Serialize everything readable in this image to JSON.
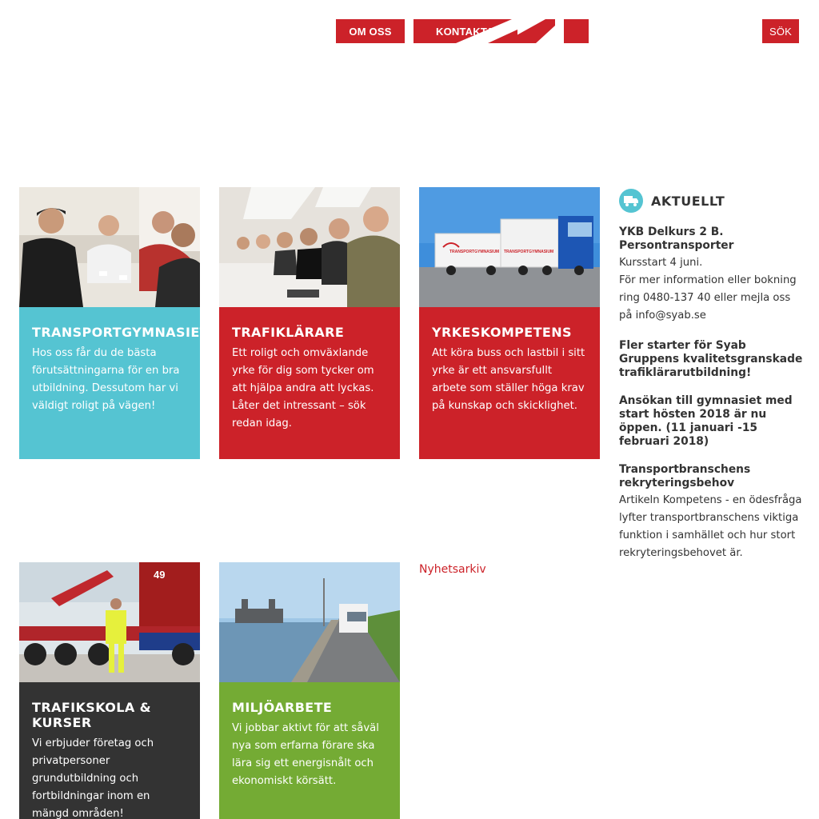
{
  "nav": {
    "about_label": "OM OSS",
    "contact_label": "KONTAKTA",
    "search_label": "SÖK"
  },
  "colors": {
    "brand_red": "#cc2229",
    "teal": "#55c4d2",
    "dark": "#333333",
    "green": "#74ab34"
  },
  "cards": [
    {
      "title": "TRANSPORTGYMNASIET",
      "text": "Hos oss får du de bästa förutsättningarna för en bra utbildning. Dessutom har vi väldigt roligt på vägen!",
      "color": "#55c4d2"
    },
    {
      "title": "TRAFIKLÄRARE",
      "text": "Ett roligt och omväxlande yrke för dig som tycker om att hjälpa andra att lyckas. Låter det intressant – sök redan idag.",
      "color": "#cc2229"
    },
    {
      "title": "YRKESKOMPETENS",
      "text": "Att köra buss och lastbil i sitt yrke är ett ansvarsfullt arbete som ställer höga krav på kunskap och skicklighet.",
      "color": "#cc2229"
    },
    {
      "title": "TRAFIKSKOLA & KURSER",
      "text": "Vi erbjuder företag och privatpersoner grundutbildning och fortbildningar inom en mängd områden!",
      "color": "#333333"
    },
    {
      "title": "MILJÖARBETE",
      "text": "Vi jobbar aktivt för att såväl nya som erfarna förare ska lära sig ett energisnålt och ekonomiskt körsätt.",
      "color": "#74ab34"
    }
  ],
  "truck_labels": [
    "TRANSPORTGYMNASIUM",
    "TRANSPORTGYMNASIUM"
  ],
  "container_number": "49",
  "aktuellt": {
    "heading": "AKTUELLT",
    "icon": "truck-icon",
    "items": [
      {
        "title": "YKB Delkurs 2 B. Persontransporter",
        "text": "Kursstart 4 juni.\nFör mer information eller bokning ring 0480-137 40 eller mejla oss på info@syab.se"
      },
      {
        "title": "Fler starter för Syab Gruppens kvalitetsgranskade trafiklärarutbildning!",
        "text": ""
      },
      {
        "title": "Ansökan till gymnasiet med start hösten 2018 är nu öppen. (11 januari -15 februari 2018)",
        "text": ""
      },
      {
        "title": "Transportbranschens rekryteringsbehov",
        "text": "Artikeln Kompetens - en ödesfråga lyfter transportbranschens viktiga funktion i samhället och hur stort rekryteringsbehovet är."
      }
    ]
  },
  "archive_label": "Nyhetsarkiv"
}
